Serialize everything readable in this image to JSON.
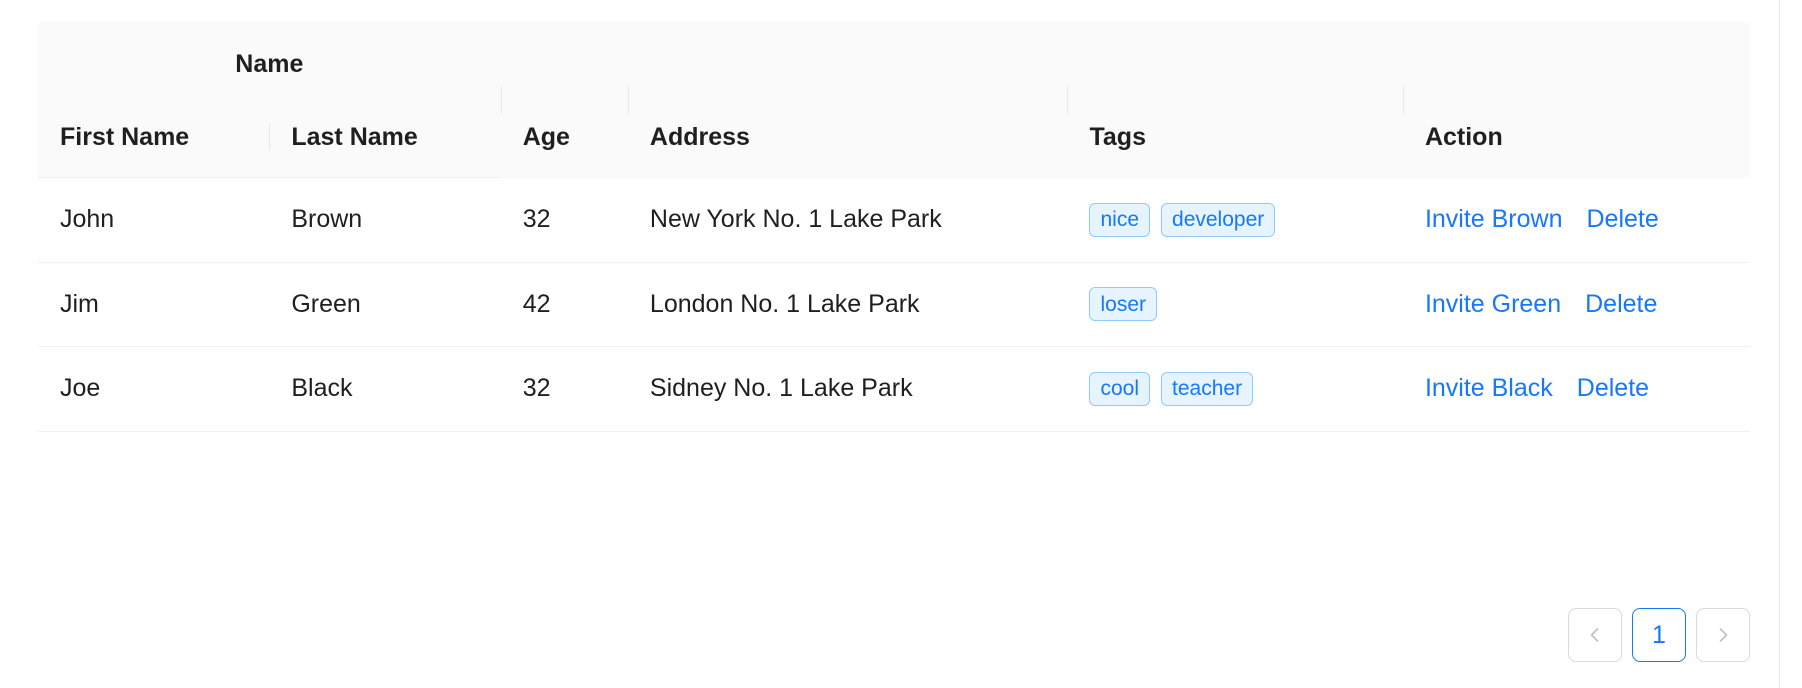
{
  "table": {
    "group_header": {
      "name": "Name"
    },
    "columns": [
      {
        "key": "first_name",
        "label": "First Name"
      },
      {
        "key": "last_name",
        "label": "Last Name"
      },
      {
        "key": "age",
        "label": "Age"
      },
      {
        "key": "address",
        "label": "Address"
      },
      {
        "key": "tags",
        "label": "Tags"
      },
      {
        "key": "action",
        "label": "Action"
      }
    ],
    "rows": [
      {
        "first_name": "John",
        "last_name": "Brown",
        "age": "32",
        "address": "New York No. 1 Lake Park",
        "tags": [
          "nice",
          "developer"
        ],
        "actions": [
          "Invite Brown",
          "Delete"
        ]
      },
      {
        "first_name": "Jim",
        "last_name": "Green",
        "age": "42",
        "address": "London No. 1 Lake Park",
        "tags": [
          "loser"
        ],
        "actions": [
          "Invite Green",
          "Delete"
        ]
      },
      {
        "first_name": "Joe",
        "last_name": "Black",
        "age": "32",
        "address": "Sidney No. 1 Lake Park",
        "tags": [
          "cool",
          "teacher"
        ],
        "actions": [
          "Invite Black",
          "Delete"
        ]
      }
    ]
  },
  "pagination": {
    "prev_icon": "chevron-left-icon",
    "next_icon": "chevron-right-icon",
    "pages": [
      "1"
    ],
    "current_page": "1"
  },
  "colors": {
    "accent": "#1677ff",
    "tag_bg": "#e6f4ff",
    "tag_border": "#91caff",
    "header_bg": "#fafafa",
    "row_border": "#f0f0f0",
    "button_border": "#d9d9d9",
    "disabled_text": "#bfbfbf"
  }
}
